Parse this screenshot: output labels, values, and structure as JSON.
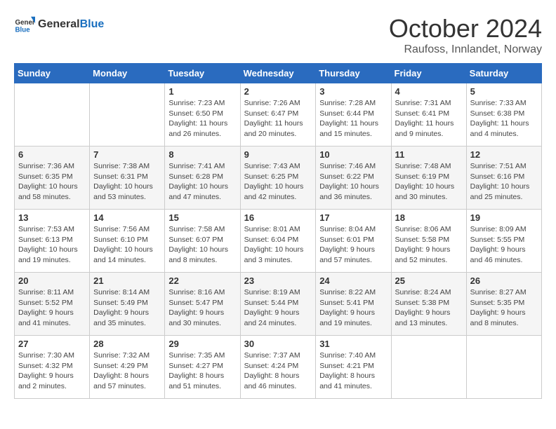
{
  "header": {
    "logo_general": "General",
    "logo_blue": "Blue",
    "month_title": "October 2024",
    "subtitle": "Raufoss, Innlandet, Norway"
  },
  "calendar": {
    "days_of_week": [
      "Sunday",
      "Monday",
      "Tuesday",
      "Wednesday",
      "Thursday",
      "Friday",
      "Saturday"
    ],
    "weeks": [
      [
        {
          "day": "",
          "info": ""
        },
        {
          "day": "",
          "info": ""
        },
        {
          "day": "1",
          "info": "Sunrise: 7:23 AM\nSunset: 6:50 PM\nDaylight: 11 hours and 26 minutes."
        },
        {
          "day": "2",
          "info": "Sunrise: 7:26 AM\nSunset: 6:47 PM\nDaylight: 11 hours and 20 minutes."
        },
        {
          "day": "3",
          "info": "Sunrise: 7:28 AM\nSunset: 6:44 PM\nDaylight: 11 hours and 15 minutes."
        },
        {
          "day": "4",
          "info": "Sunrise: 7:31 AM\nSunset: 6:41 PM\nDaylight: 11 hours and 9 minutes."
        },
        {
          "day": "5",
          "info": "Sunrise: 7:33 AM\nSunset: 6:38 PM\nDaylight: 11 hours and 4 minutes."
        }
      ],
      [
        {
          "day": "6",
          "info": "Sunrise: 7:36 AM\nSunset: 6:35 PM\nDaylight: 10 hours and 58 minutes."
        },
        {
          "day": "7",
          "info": "Sunrise: 7:38 AM\nSunset: 6:31 PM\nDaylight: 10 hours and 53 minutes."
        },
        {
          "day": "8",
          "info": "Sunrise: 7:41 AM\nSunset: 6:28 PM\nDaylight: 10 hours and 47 minutes."
        },
        {
          "day": "9",
          "info": "Sunrise: 7:43 AM\nSunset: 6:25 PM\nDaylight: 10 hours and 42 minutes."
        },
        {
          "day": "10",
          "info": "Sunrise: 7:46 AM\nSunset: 6:22 PM\nDaylight: 10 hours and 36 minutes."
        },
        {
          "day": "11",
          "info": "Sunrise: 7:48 AM\nSunset: 6:19 PM\nDaylight: 10 hours and 30 minutes."
        },
        {
          "day": "12",
          "info": "Sunrise: 7:51 AM\nSunset: 6:16 PM\nDaylight: 10 hours and 25 minutes."
        }
      ],
      [
        {
          "day": "13",
          "info": "Sunrise: 7:53 AM\nSunset: 6:13 PM\nDaylight: 10 hours and 19 minutes."
        },
        {
          "day": "14",
          "info": "Sunrise: 7:56 AM\nSunset: 6:10 PM\nDaylight: 10 hours and 14 minutes."
        },
        {
          "day": "15",
          "info": "Sunrise: 7:58 AM\nSunset: 6:07 PM\nDaylight: 10 hours and 8 minutes."
        },
        {
          "day": "16",
          "info": "Sunrise: 8:01 AM\nSunset: 6:04 PM\nDaylight: 10 hours and 3 minutes."
        },
        {
          "day": "17",
          "info": "Sunrise: 8:04 AM\nSunset: 6:01 PM\nDaylight: 9 hours and 57 minutes."
        },
        {
          "day": "18",
          "info": "Sunrise: 8:06 AM\nSunset: 5:58 PM\nDaylight: 9 hours and 52 minutes."
        },
        {
          "day": "19",
          "info": "Sunrise: 8:09 AM\nSunset: 5:55 PM\nDaylight: 9 hours and 46 minutes."
        }
      ],
      [
        {
          "day": "20",
          "info": "Sunrise: 8:11 AM\nSunset: 5:52 PM\nDaylight: 9 hours and 41 minutes."
        },
        {
          "day": "21",
          "info": "Sunrise: 8:14 AM\nSunset: 5:49 PM\nDaylight: 9 hours and 35 minutes."
        },
        {
          "day": "22",
          "info": "Sunrise: 8:16 AM\nSunset: 5:47 PM\nDaylight: 9 hours and 30 minutes."
        },
        {
          "day": "23",
          "info": "Sunrise: 8:19 AM\nSunset: 5:44 PM\nDaylight: 9 hours and 24 minutes."
        },
        {
          "day": "24",
          "info": "Sunrise: 8:22 AM\nSunset: 5:41 PM\nDaylight: 9 hours and 19 minutes."
        },
        {
          "day": "25",
          "info": "Sunrise: 8:24 AM\nSunset: 5:38 PM\nDaylight: 9 hours and 13 minutes."
        },
        {
          "day": "26",
          "info": "Sunrise: 8:27 AM\nSunset: 5:35 PM\nDaylight: 9 hours and 8 minutes."
        }
      ],
      [
        {
          "day": "27",
          "info": "Sunrise: 7:30 AM\nSunset: 4:32 PM\nDaylight: 9 hours and 2 minutes."
        },
        {
          "day": "28",
          "info": "Sunrise: 7:32 AM\nSunset: 4:29 PM\nDaylight: 8 hours and 57 minutes."
        },
        {
          "day": "29",
          "info": "Sunrise: 7:35 AM\nSunset: 4:27 PM\nDaylight: 8 hours and 51 minutes."
        },
        {
          "day": "30",
          "info": "Sunrise: 7:37 AM\nSunset: 4:24 PM\nDaylight: 8 hours and 46 minutes."
        },
        {
          "day": "31",
          "info": "Sunrise: 7:40 AM\nSunset: 4:21 PM\nDaylight: 8 hours and 41 minutes."
        },
        {
          "day": "",
          "info": ""
        },
        {
          "day": "",
          "info": ""
        }
      ]
    ]
  }
}
